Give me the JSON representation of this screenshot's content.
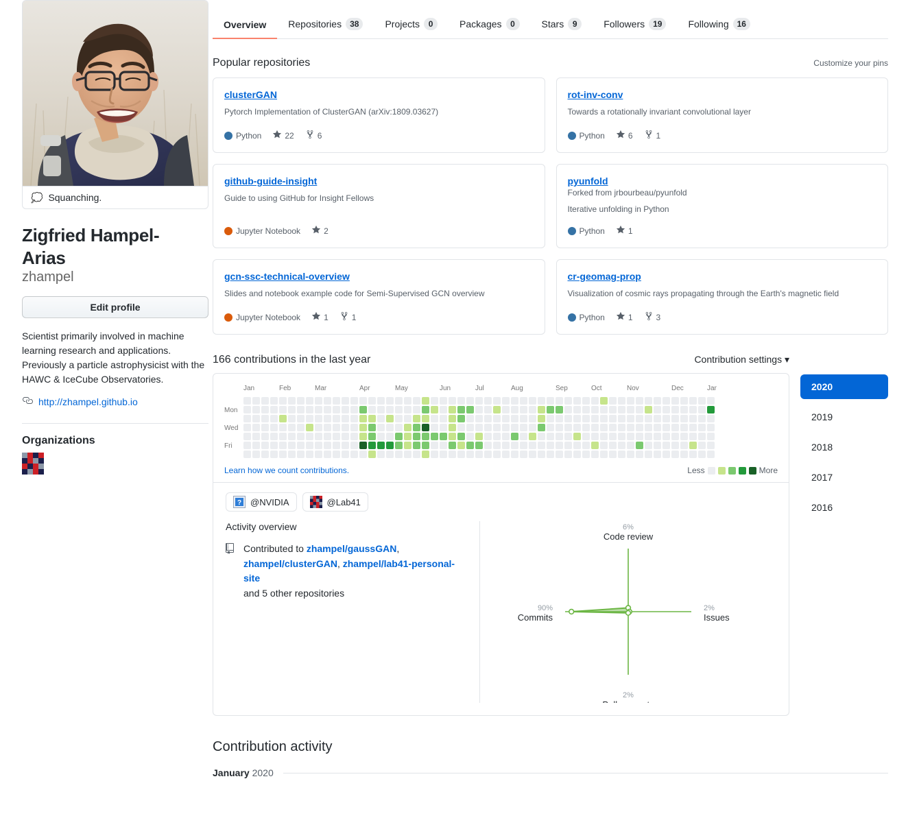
{
  "profile": {
    "status_emoji": "thought-balloon",
    "status_text": "Squanching.",
    "fullname": "Zigfried Hampel-Arias",
    "username": "zhampel",
    "edit_button": "Edit profile",
    "bio": "Scientist primarily involved in machine learning research and applications. Previously a particle astrophysicist with the HAWC & IceCube Observatories.",
    "website": "http://zhampel.github.io",
    "organizations_title": "Organizations",
    "organizations": [
      {
        "name": "Lab41",
        "avatar": "lab41-checker"
      }
    ]
  },
  "tabs": [
    {
      "label": "Overview",
      "count": null,
      "active": true
    },
    {
      "label": "Repositories",
      "count": "38",
      "active": false
    },
    {
      "label": "Projects",
      "count": "0",
      "active": false
    },
    {
      "label": "Packages",
      "count": "0",
      "active": false
    },
    {
      "label": "Stars",
      "count": "9",
      "active": false
    },
    {
      "label": "Followers",
      "count": "19",
      "active": false
    },
    {
      "label": "Following",
      "count": "16",
      "active": false
    }
  ],
  "pinned": {
    "title": "Popular repositories",
    "customize_label": "Customize your pins",
    "repos": [
      {
        "name": "clusterGAN",
        "forked_from": null,
        "description": "Pytorch Implementation of ClusterGAN (arXiv:1809.03627)",
        "language": "Python",
        "language_color": "#3572A5",
        "stars": "22",
        "forks": "6"
      },
      {
        "name": "rot-inv-conv",
        "forked_from": null,
        "description": "Towards a rotationally invariant convolutional layer",
        "language": "Python",
        "language_color": "#3572A5",
        "stars": "6",
        "forks": "1"
      },
      {
        "name": "github-guide-insight",
        "forked_from": null,
        "description": "Guide to using GitHub for Insight Fellows",
        "language": "Jupyter Notebook",
        "language_color": "#DA5B0B",
        "stars": "2",
        "forks": null
      },
      {
        "name": "pyunfold",
        "forked_from": "Forked from jrbourbeau/pyunfold",
        "description": "Iterative unfolding in Python",
        "language": "Python",
        "language_color": "#3572A5",
        "stars": "1",
        "forks": null
      },
      {
        "name": "gcn-ssc-technical-overview",
        "forked_from": null,
        "description": "Slides and notebook example code for Semi-Supervised GCN overview",
        "language": "Jupyter Notebook",
        "language_color": "#DA5B0B",
        "stars": "1",
        "forks": "1"
      },
      {
        "name": "cr-geomag-prop",
        "forked_from": null,
        "description": "Visualization of cosmic rays propagating through the Earth's magnetic field",
        "language": "Python",
        "language_color": "#3572A5",
        "stars": "1",
        "forks": "3"
      }
    ]
  },
  "contributions": {
    "heading": "166 contributions in the last year",
    "settings_label": "Contribution settings",
    "learn_link": "Learn how we count contributions.",
    "legend_less": "Less",
    "legend_more": "More",
    "legend_colors": [
      "#ebedf0",
      "#c6e48b",
      "#7bc96f",
      "#239a3b",
      "#196127"
    ],
    "months": [
      "Jan",
      "Feb",
      "Mar",
      "Apr",
      "May",
      "Jun",
      "Jul",
      "Aug",
      "Sep",
      "Oct",
      "Nov",
      "Dec",
      "Jan"
    ],
    "weekdays": [
      "",
      "Mon",
      "",
      "Wed",
      "",
      "Fri",
      ""
    ],
    "years": [
      {
        "label": "2020",
        "active": true
      },
      {
        "label": "2019",
        "active": false
      },
      {
        "label": "2018",
        "active": false
      },
      {
        "label": "2017",
        "active": false
      },
      {
        "label": "2016",
        "active": false
      }
    ]
  },
  "chart_data": {
    "type": "heatmap",
    "title": "166 contributions in the last year",
    "xlabel": "",
    "ylabel": "",
    "x_tick_labels": [
      "Jan",
      "Feb",
      "Mar",
      "Apr",
      "May",
      "Jun",
      "Jul",
      "Aug",
      "Sep",
      "Oct",
      "Nov",
      "Dec",
      "Jan"
    ],
    "y_tick_labels": [
      "",
      "Mon",
      "",
      "Wed",
      "",
      "Fri",
      ""
    ],
    "level_colors": [
      "#ebedf0",
      "#c6e48b",
      "#7bc96f",
      "#239a3b",
      "#196127"
    ],
    "weeks": 53,
    "days_per_week": 7,
    "levels": [
      [
        0,
        0,
        0,
        0,
        0,
        0,
        0
      ],
      [
        0,
        0,
        0,
        0,
        0,
        0,
        0
      ],
      [
        0,
        0,
        0,
        0,
        0,
        0,
        0
      ],
      [
        0,
        0,
        0,
        0,
        0,
        0,
        0
      ],
      [
        0,
        0,
        1,
        0,
        0,
        0,
        0
      ],
      [
        0,
        0,
        0,
        0,
        0,
        0,
        0
      ],
      [
        0,
        0,
        0,
        0,
        0,
        0,
        0
      ],
      [
        0,
        0,
        0,
        1,
        0,
        0,
        0
      ],
      [
        0,
        0,
        0,
        0,
        0,
        0,
        0
      ],
      [
        0,
        0,
        0,
        0,
        0,
        0,
        0
      ],
      [
        0,
        0,
        0,
        0,
        0,
        0,
        0
      ],
      [
        0,
        0,
        0,
        0,
        0,
        0,
        0
      ],
      [
        0,
        0,
        0,
        0,
        0,
        0,
        0
      ],
      [
        0,
        2,
        1,
        1,
        1,
        4,
        0
      ],
      [
        0,
        0,
        1,
        2,
        2,
        3,
        1
      ],
      [
        0,
        0,
        0,
        0,
        0,
        3,
        0
      ],
      [
        0,
        0,
        1,
        0,
        0,
        3,
        0
      ],
      [
        0,
        0,
        0,
        0,
        2,
        2,
        0
      ],
      [
        0,
        0,
        0,
        1,
        1,
        1,
        0
      ],
      [
        0,
        0,
        1,
        2,
        2,
        2,
        0
      ],
      [
        1,
        2,
        1,
        4,
        2,
        2,
        1
      ],
      [
        0,
        1,
        0,
        0,
        2,
        0,
        0
      ],
      [
        0,
        0,
        0,
        0,
        2,
        0,
        0
      ],
      [
        0,
        1,
        1,
        1,
        1,
        2,
        0
      ],
      [
        0,
        2,
        2,
        0,
        2,
        1,
        0
      ],
      [
        0,
        2,
        0,
        0,
        0,
        2,
        0
      ],
      [
        0,
        0,
        0,
        0,
        1,
        2,
        0
      ],
      [
        0,
        0,
        0,
        0,
        0,
        0,
        0
      ],
      [
        0,
        1,
        0,
        0,
        0,
        0,
        0
      ],
      [
        0,
        0,
        0,
        0,
        0,
        0,
        0
      ],
      [
        0,
        0,
        0,
        0,
        2,
        0,
        0
      ],
      [
        0,
        0,
        0,
        0,
        0,
        0,
        0
      ],
      [
        0,
        0,
        0,
        0,
        1,
        0,
        0
      ],
      [
        0,
        1,
        1,
        2,
        0,
        0,
        0
      ],
      [
        0,
        2,
        0,
        0,
        0,
        0,
        0
      ],
      [
        0,
        2,
        0,
        0,
        0,
        0,
        0
      ],
      [
        0,
        0,
        0,
        0,
        0,
        0,
        0
      ],
      [
        0,
        0,
        0,
        0,
        1,
        0,
        0
      ],
      [
        0,
        0,
        0,
        0,
        0,
        0,
        0
      ],
      [
        0,
        0,
        0,
        0,
        0,
        1,
        0
      ],
      [
        1,
        0,
        0,
        0,
        0,
        0,
        0
      ],
      [
        0,
        0,
        0,
        0,
        0,
        0,
        0
      ],
      [
        0,
        0,
        0,
        0,
        0,
        0,
        0
      ],
      [
        0,
        0,
        0,
        0,
        0,
        0,
        0
      ],
      [
        0,
        0,
        0,
        0,
        0,
        2,
        0
      ],
      [
        0,
        1,
        0,
        0,
        0,
        0,
        0
      ],
      [
        0,
        0,
        0,
        0,
        0,
        0,
        0
      ],
      [
        0,
        0,
        0,
        0,
        0,
        0,
        0
      ],
      [
        0,
        0,
        0,
        0,
        0,
        0,
        0
      ],
      [
        0,
        0,
        0,
        0,
        0,
        0,
        0
      ],
      [
        0,
        0,
        0,
        0,
        0,
        1,
        0
      ],
      [
        0,
        0,
        0,
        0,
        0,
        0,
        0
      ],
      [
        0,
        3,
        0,
        0,
        0,
        0,
        0
      ]
    ]
  },
  "org_tabs": [
    {
      "label": "@NVIDIA",
      "icon": "broken-image-icon"
    },
    {
      "label": "@Lab41",
      "icon": "lab41-checker"
    }
  ],
  "activity": {
    "title": "Activity overview",
    "icon": "repo-icon",
    "prefix": "Contributed to ",
    "repos": [
      "zhampel/gaussGAN",
      "zhampel/clusterGAN",
      "zhampel/lab41-personal-site"
    ],
    "suffix": "and 5 other repositories"
  },
  "activity_chart": {
    "type": "radar",
    "title": "Activity overview",
    "axes": [
      {
        "name": "Code review",
        "value": 6,
        "label": "6%",
        "position": "top"
      },
      {
        "name": "Issues",
        "value": 2,
        "label": "2%",
        "position": "right"
      },
      {
        "name": "Pull requests",
        "value": 2,
        "label": "2%",
        "position": "bottom"
      },
      {
        "name": "Commits",
        "value": 90,
        "label": "90%",
        "position": "left"
      }
    ],
    "color": "#6cb644",
    "max": 100
  },
  "contribution_activity": {
    "title": "Contribution activity",
    "month": "January",
    "year": "2020"
  }
}
